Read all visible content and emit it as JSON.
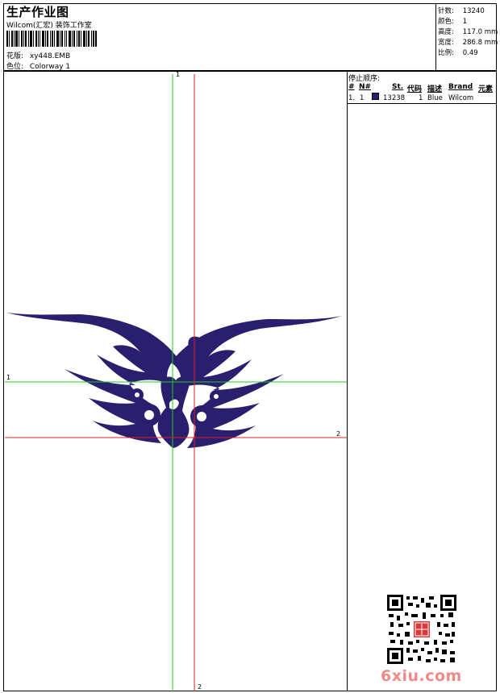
{
  "header": {
    "title": "生产作业图",
    "subtitle": "Wilcom(汇宏) 装饰工作室",
    "design_label": "花版:",
    "design_value": "xy448.EMB",
    "colorway_label": "色位:",
    "colorway_value": "Colorway 1"
  },
  "stats": {
    "stitches_label": "针数:",
    "stitches_value": "13240",
    "colors_label": "颜色:",
    "colors_value": "1",
    "height_label": "高度:",
    "height_value": "117.0 mm",
    "width_label": "宽度:",
    "width_value": "286.8 mm",
    "scale_label": "比例:",
    "scale_value": "0.49"
  },
  "stop_sequence": {
    "title": "停止顺序:",
    "columns": [
      "#",
      "N#",
      "St.",
      "代码",
      "描述",
      "Brand",
      "元素"
    ],
    "rows": [
      {
        "index": "1.",
        "needle": "1",
        "stitches": "13238",
        "code": "1",
        "description": "Blue",
        "brand": "Wilcom",
        "swatch_color": "#2a1f6e"
      }
    ]
  },
  "guides": {
    "vertical_1_label": "1",
    "horizontal_1_label": "1",
    "horizontal_2_label": "2",
    "vertical_2_label": "2"
  },
  "watermark": {
    "text": "6xiu.com",
    "color": "#f08a8a"
  },
  "colors": {
    "thread": "#2a1f6e",
    "guide_green": "#22cc22",
    "guide_red": "#dd2222"
  }
}
